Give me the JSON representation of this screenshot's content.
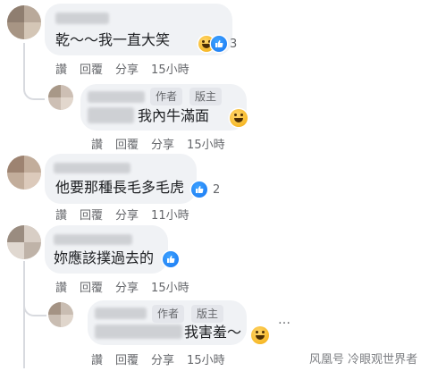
{
  "comments": [
    {
      "text": "乾～～我一直大笑",
      "reaction_count": "3",
      "actions": [
        "讚",
        "回覆",
        "分享",
        "15小時"
      ]
    },
    {
      "badges": [
        "作者",
        "版主"
      ],
      "text": "我內牛滿面",
      "actions": [
        "讚",
        "回覆",
        "分享",
        "15小時"
      ]
    },
    {
      "text": "他要那種長毛多毛虎",
      "reaction_count": "2",
      "actions": [
        "讚",
        "回覆",
        "分享",
        "11小時"
      ]
    },
    {
      "text": "妳應該撲過去的",
      "actions": [
        "讚",
        "回覆",
        "分享",
        "15小時"
      ]
    },
    {
      "badges": [
        "作者",
        "版主"
      ],
      "text": "我害羞～",
      "actions": [
        "讚",
        "回覆",
        "分享",
        "15小時"
      ]
    }
  ],
  "more_icon": "…",
  "watermark": "风凰号 冷眼观世界者",
  "icons": {
    "haha": "haha-emoji-icon",
    "like": "like-reaction-icon",
    "more": "more-options-icon"
  },
  "colors": {
    "bubble": "#f0f2f5",
    "like_blue": "#1877f2",
    "haha_yellow": "#f7b928",
    "meta_gray": "#65676b"
  }
}
